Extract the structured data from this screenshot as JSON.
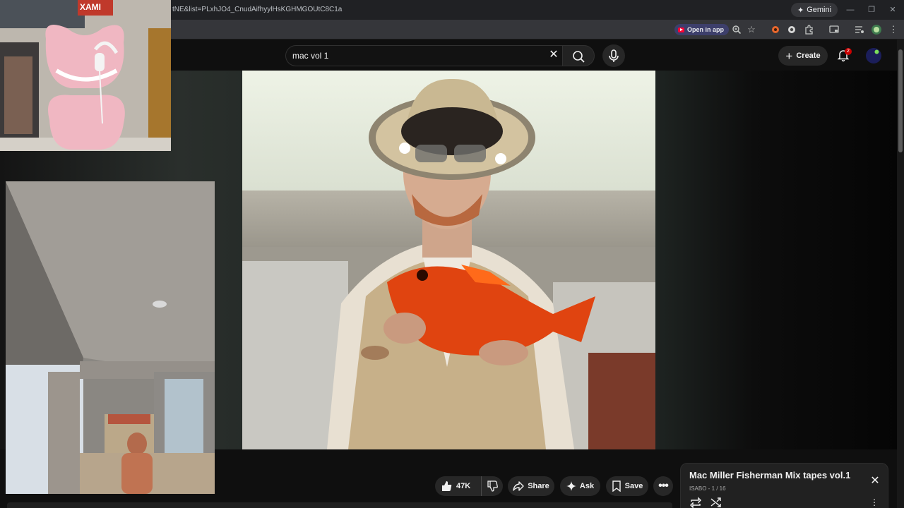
{
  "browser": {
    "gemini_label": "Gemini",
    "url": "tNE&list=PLxhJO4_CnudAifhyylHsKGHMGOUtC8C1a",
    "open_in_app_label": "Open in app"
  },
  "header": {
    "search_query": "mac vol 1",
    "create_label": "Create",
    "notification_count": "2"
  },
  "actions": {
    "like_count": "47K",
    "share_label": "Share",
    "ask_label": "Ask",
    "save_label": "Save"
  },
  "playlist": {
    "title": "Mac Miller Fisherman Mix tapes vol.1",
    "channel_position": "ISABO - 1 / 16"
  },
  "overlay": {
    "poster_text": "XAMI"
  },
  "colors": {
    "page_bg": "#0f0f0f",
    "accent_red": "#cc0000",
    "pill_bg": "#272727",
    "open_in_app_bg": "#3d3f6b"
  }
}
